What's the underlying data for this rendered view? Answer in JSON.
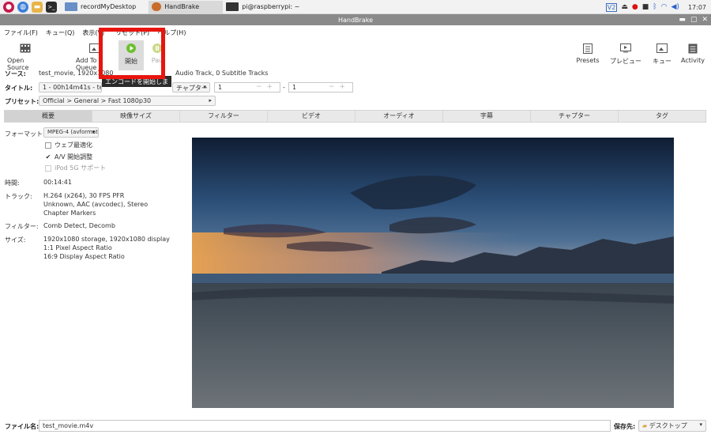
{
  "taskbar": {
    "tasks": [
      {
        "label": "recordMyDesktop"
      },
      {
        "label": "HandBrake"
      },
      {
        "label": "pi@raspberrypi: ~"
      }
    ],
    "clock": "17:07"
  },
  "window": {
    "title": "HandBrake"
  },
  "menu": [
    "ファイル(F)",
    "キュー(Q)",
    "表示(V)",
    "リセット(P)",
    "ヘルプ(H)"
  ],
  "toolbar": {
    "open_source": "Open Source",
    "add_to_queue": "Add To Queue",
    "start": "開始",
    "pause": "Pau",
    "presets": "Presets",
    "preview": "プレビュー",
    "queue": "キュー",
    "activity": "Activity",
    "tooltip": "エンコードを開始します"
  },
  "source": {
    "label": "ソース:",
    "value": "test_movie, 1920x1080",
    "tracks": "Audio Track, 0 Subtitle Tracks"
  },
  "title": {
    "label": "タイトル:",
    "value": "1 - 00h14m41s - test_",
    "range_type": "チャプター",
    "from": "1",
    "dash": "-",
    "to": "1"
  },
  "preset": {
    "label": "プリセット:",
    "value": "Official > General > Fast 1080p30"
  },
  "tabs": [
    "概要",
    "映像サイズ",
    "フィルター",
    "ビデオ",
    "オーディオ",
    "字幕",
    "チャプター",
    "タグ"
  ],
  "summary": {
    "format_label": "フォーマット:",
    "format_value": "MPEG-4 (avformat)",
    "web_optimized": "ウェブ最適化",
    "av_align": "A/V 開始調整",
    "ipod": "iPod 5G サポート",
    "duration_label": "時間:",
    "duration_value": "00:14:41",
    "tracks_label": "トラック:",
    "tracks": [
      "H.264 (x264), 30 FPS PFR",
      "Unknown, AAC (avcodec), Stereo",
      "Chapter Markers"
    ],
    "filters_label": "フィルター:",
    "filters_value": "Comb Detect, Decomb",
    "size_label": "サイズ:",
    "size": [
      "1920x1080 storage, 1920x1080 display",
      "1:1 Pixel Aspect Ratio",
      "16:9 Display Aspect Ratio"
    ]
  },
  "bottom": {
    "filename_label": "ファイル名:",
    "filename_value": "test_movie.m4v",
    "save_label": "保存先:",
    "save_value": "デスクトップ"
  },
  "colors": {
    "highlight": "#e8140e",
    "titlebar": "#8a8a8a"
  }
}
